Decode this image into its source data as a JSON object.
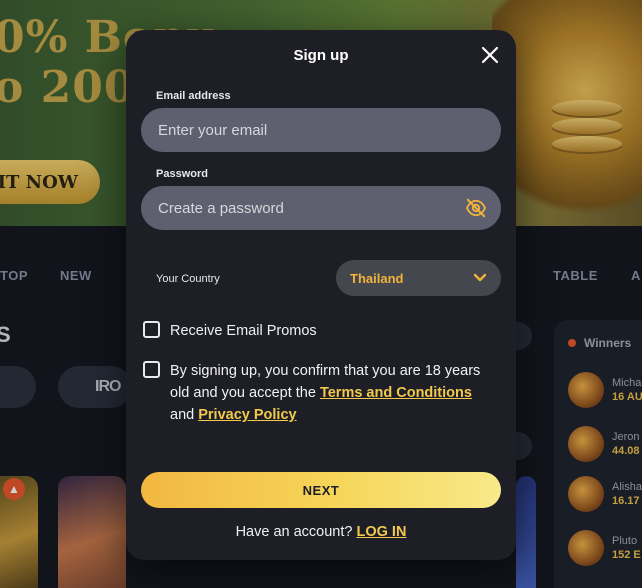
{
  "background": {
    "hero_line1": "0% Bonu",
    "hero_line2": "o 200",
    "hero_cta": "IT NOW",
    "nav": [
      "TOP",
      "NEW",
      "TABLE",
      "A"
    ],
    "section_title": "S",
    "provider_label": "IRO",
    "winners_title": "Winners",
    "winners": [
      {
        "name": "Micha",
        "amount": "16 AU"
      },
      {
        "name": "Jeron",
        "amount": "44.08"
      },
      {
        "name": "Alisha",
        "amount": "16.17"
      },
      {
        "name": "Pluto",
        "amount": "152 E"
      }
    ]
  },
  "modal": {
    "title": "Sign up",
    "email": {
      "label": "Email address",
      "placeholder": "Enter your email",
      "value": ""
    },
    "password": {
      "label": "Password",
      "placeholder": "Create a password",
      "value": ""
    },
    "country": {
      "label": "Your Country",
      "selected": "Thailand"
    },
    "promos": {
      "label": "Receive Email Promos",
      "checked": false
    },
    "terms": {
      "checked": false,
      "text_before": "By signing up, you confirm that you are 18 years old and you accept the ",
      "terms_link": "Terms and Conditions",
      "text_middle": " and ",
      "privacy_link": "Privacy Policy"
    },
    "next_label": "NEXT",
    "footer_text": "Have an account? ",
    "login_link": "LOG IN"
  },
  "colors": {
    "modal_bg": "#1e1f26",
    "input_bg": "#5e6070",
    "accent": "#f2b33a",
    "link": "#f2c94c"
  },
  "icons": {
    "close": "close-icon",
    "password_toggle": "eye-off-icon",
    "select": "chevron-down-icon",
    "fire": "fire-icon"
  }
}
